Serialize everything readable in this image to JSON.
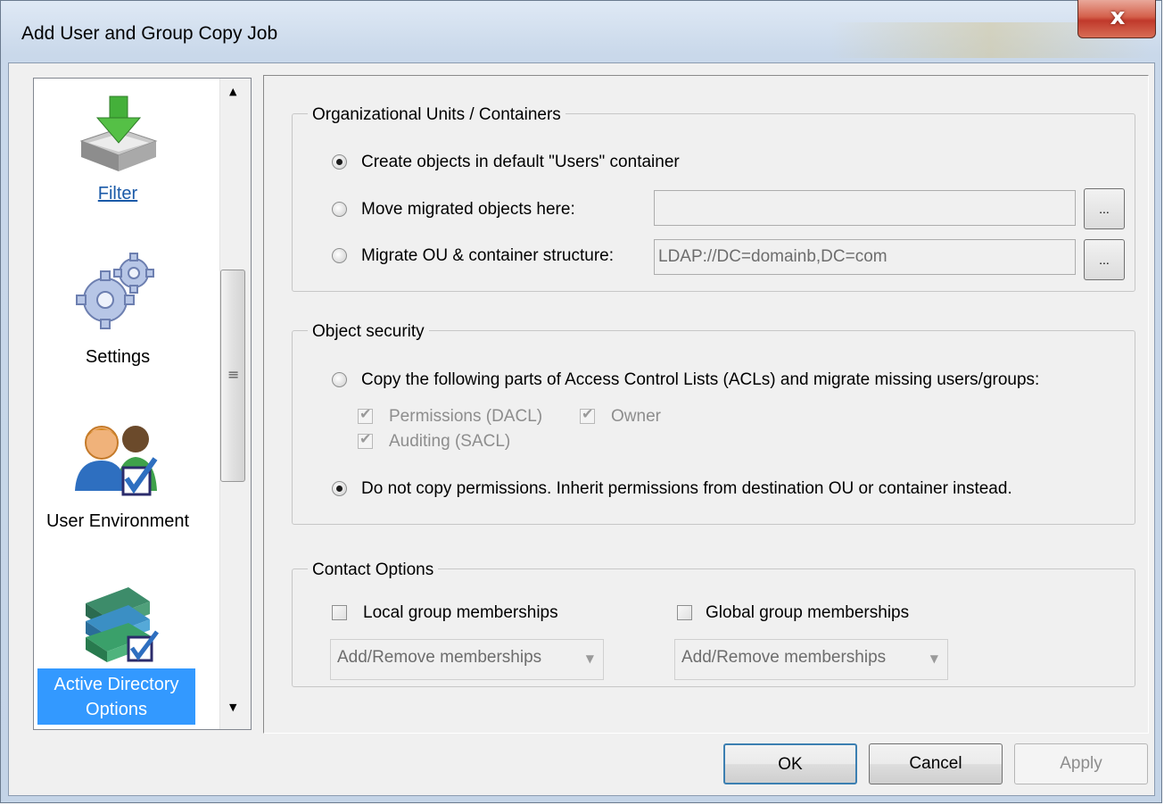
{
  "window": {
    "title": "Add User and Group Copy Job",
    "close_glyph": "x"
  },
  "nav": {
    "items": [
      {
        "label": "Filter",
        "icon": "filter-download-icon"
      },
      {
        "label": "Settings",
        "icon": "gears-icon"
      },
      {
        "label": "User Environment",
        "icon": "users-check-icon"
      },
      {
        "label": "Active Directory Options",
        "icon": "books-check-icon",
        "selected": true
      }
    ],
    "scroll_up": "▲",
    "scroll_down": "▼",
    "grip": "≡"
  },
  "ou_group": {
    "legend": "Organizational Units / Containers",
    "options": [
      {
        "label": "Create objects in default \"Users\" container",
        "checked": true
      },
      {
        "label": "Move migrated objects here:",
        "checked": false,
        "value": ""
      },
      {
        "label": "Migrate OU & container structure:",
        "checked": false,
        "value": "LDAP://DC=domainb,DC=com"
      }
    ],
    "browse_label": "..."
  },
  "security_group": {
    "legend": "Object security",
    "copy_option": {
      "label": "Copy the following parts of Access Control Lists (ACLs) and migrate missing users/groups:",
      "checked": false
    },
    "sub_checks": [
      {
        "label": "Permissions (DACL)",
        "checked": true,
        "disabled": true
      },
      {
        "label": "Owner",
        "checked": true,
        "disabled": true
      },
      {
        "label": "Auditing (SACL)",
        "checked": true,
        "disabled": true
      }
    ],
    "no_copy_option": {
      "label": "Do not copy permissions. Inherit permissions from destination OU or container instead.",
      "checked": true
    }
  },
  "contact_group": {
    "legend": "Contact Options",
    "local": {
      "label": "Local group memberships",
      "checked": false,
      "combo": "Add/Remove memberships"
    },
    "global": {
      "label": "Global group memberships",
      "checked": false,
      "combo": "Add/Remove memberships"
    }
  },
  "buttons": {
    "ok": "OK",
    "cancel": "Cancel",
    "apply": "Apply"
  },
  "colors": {
    "selection": "#3399ff",
    "link": "#1a5aa8",
    "close_red": "#c0392b"
  }
}
